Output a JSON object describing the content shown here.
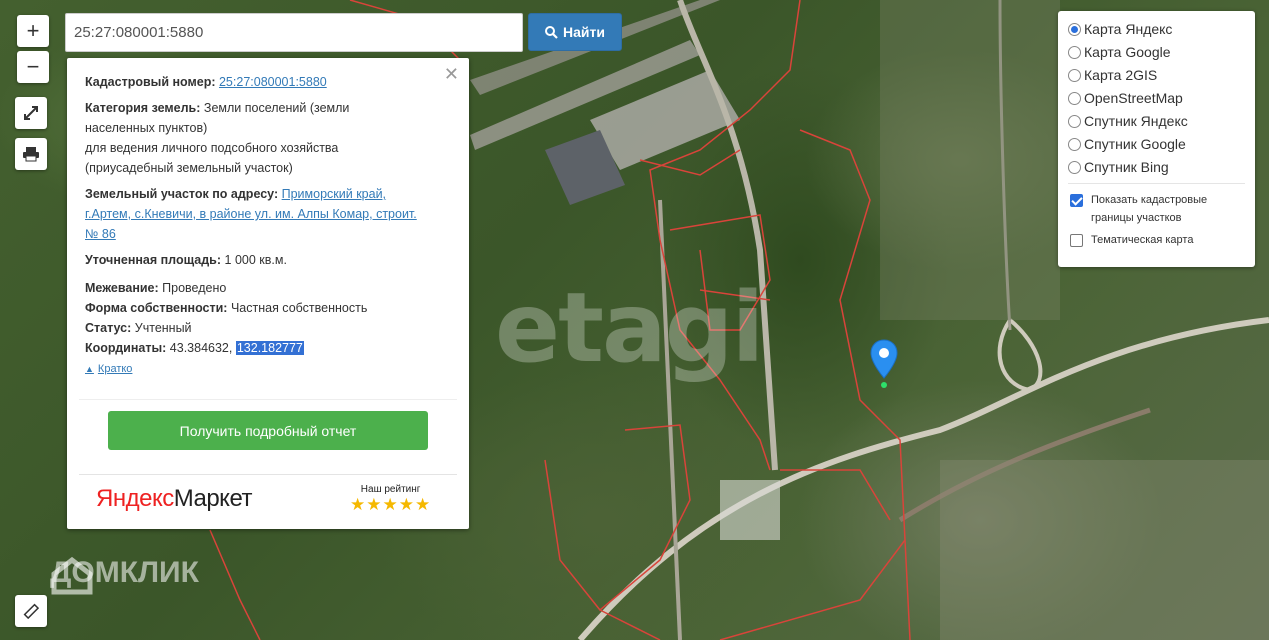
{
  "search": {
    "value": "25:27:080001:5880",
    "button_label": "Найти"
  },
  "zoom": {
    "in_label": "+",
    "out_label": "−"
  },
  "info": {
    "cadastral_label": "Кадастровый номер:",
    "cadastral_value": "25:27:080001:5880",
    "category_label": "Категория земель:",
    "category_value_1": "Земли поселений (земли",
    "category_value_2": "населенных пунктов)",
    "category_value_3": "для ведения личного подсобного хозяйства",
    "category_value_4": "(приусадебный земельный участок)",
    "address_label": "Земельный участок по адресу:",
    "address_value_1": "Приморский край,",
    "address_value_2": "г.Артем, с.Кневичи, в районе ул. им. Алпы Комар, строит.",
    "address_value_3": "№ 86",
    "area_label": "Уточненная площадь:",
    "area_value": "1 000 кв.м.",
    "survey_label": "Межевание:",
    "survey_value": "Проведено",
    "ownership_label": "Форма собственности:",
    "ownership_value": "Частная собственность",
    "status_label": "Статус:",
    "status_value": "Учтенный",
    "coords_label": "Координаты:",
    "coords_lat": "43.384632,",
    "coords_lon": "132.182777",
    "collapse_link": "Кратко",
    "report_button": "Получить подробный отчет",
    "ym_brand_1": "Яндекс",
    "ym_brand_2": "Маркет",
    "rating_label": "Наш рейтинг",
    "rating_stars": 5,
    "stars_text": "★★★★★"
  },
  "layers": {
    "options": [
      "Карта Яндекс",
      "Карта Google",
      "Карта 2GIS",
      "OpenStreetMap",
      "Спутник Яндекс",
      "Спутник Google",
      "Спутник Bing"
    ],
    "selected": "Карта Яндекс",
    "show_borders_1": "Показать кадастровые",
    "show_borders_2": "границы участков",
    "show_borders_checked": true,
    "thematic_label": "Тематическая карта",
    "thematic_checked": false
  },
  "watermarks": {
    "etagi": "etagi",
    "domclick": "ДОМКЛИК"
  },
  "colors": {
    "accent": "#337ab7",
    "report": "#4cb04c",
    "pin": "#2a8ff0",
    "boundary": "#d9443a"
  }
}
